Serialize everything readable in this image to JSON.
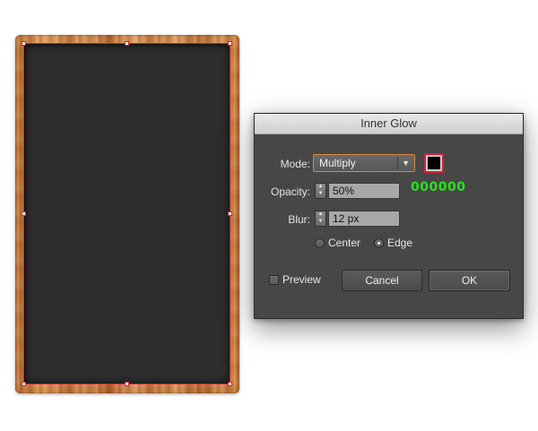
{
  "dialog": {
    "title": "Inner Glow",
    "mode_label": "Mode:",
    "mode_value": "Multiply",
    "color_swatch": "#000000",
    "color_hex_label": "000000",
    "opacity_label": "Opacity:",
    "opacity_value": "50%",
    "blur_label": "Blur:",
    "blur_value": "12 px",
    "position_options": [
      {
        "label": "Center",
        "checked": false
      },
      {
        "label": "Edge",
        "checked": true
      }
    ],
    "preview_label": "Preview",
    "preview_checked": false,
    "cancel_label": "Cancel",
    "ok_label": "OK"
  },
  "artboard": {
    "frame_material": "wood",
    "board_color": "#2d2d2d",
    "selection_color": "#d6203a"
  },
  "icons": {
    "select_arrow": "triangle-down-icon",
    "stepper": "up-down-arrows-icon"
  },
  "colors": {
    "hex_label_color": "#27e31c",
    "dialog_bg": "#474747",
    "select_border": "#d98a3a"
  }
}
